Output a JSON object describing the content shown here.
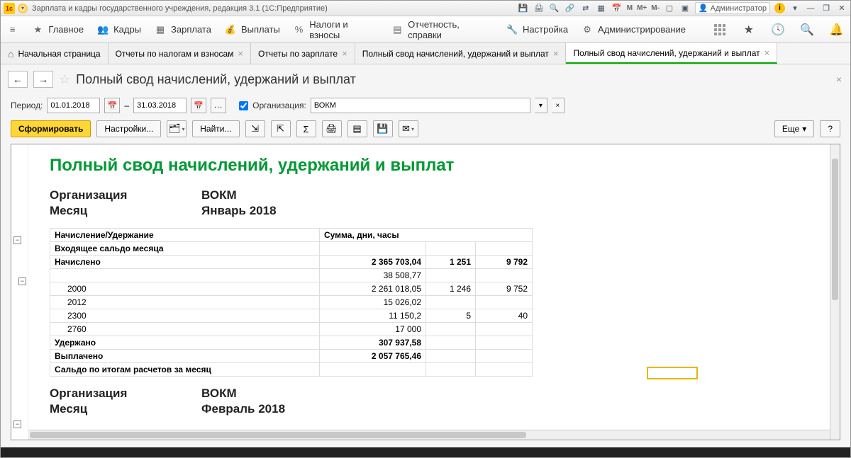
{
  "titlebar": {
    "title": "Зарплата и кадры государственного учреждения, редакция 3.1  (1С:Предприятие)",
    "m1": "M",
    "m2": "M+",
    "m3": "M-",
    "user": "Администратор"
  },
  "menu": {
    "main": "Главное",
    "kadry": "Кадры",
    "zarplata": "Зарплата",
    "vyplaty": "Выплаты",
    "nalogi": "Налоги и взносы",
    "otchet": "Отчетность, справки",
    "nastroyka": "Настройка",
    "admin": "Администрирование"
  },
  "tabs": {
    "home": "Начальная страница",
    "t1": "Отчеты по налогам и взносам",
    "t2": "Отчеты по зарплате",
    "t3": "Полный свод начислений, удержаний и выплат",
    "t4": "Полный свод начислений, удержаний и выплат"
  },
  "page": {
    "title": "Полный свод начислений, удержаний и выплат"
  },
  "filter": {
    "period_label": "Период:",
    "date_from": "01.01.2018",
    "dash": "–",
    "date_to": "31.03.2018",
    "org_label": "Организация:",
    "org_value": "ВОКМ"
  },
  "toolbar": {
    "generate": "Сформировать",
    "settings": "Настройки...",
    "find": "Найти...",
    "more": "Еще",
    "help": "?"
  },
  "report": {
    "title": "Полный свод начислений, удержаний и выплат",
    "org_label": "Организация",
    "org": "ВОКМ",
    "month_label": "Месяц",
    "month1": "Январь 2018",
    "month2": "Февраль 2018",
    "th_name": "Начисление/Удержание",
    "th_sum": "Сумма, дни, часы",
    "rows": {
      "r0": "Входящее сальдо месяца",
      "r1": "Начислено",
      "r1_sum": "2 365 703,04",
      "r1_d": "1 251",
      "r1_h": "9 792",
      "r2_sum": "38 508,77",
      "r3": "2000",
      "r3_sum": "2 261 018,05",
      "r3_d": "1 246",
      "r3_h": "9 752",
      "r4": "2012",
      "r4_sum": "15 026,02",
      "r5": "2300",
      "r5_sum": "11 150,2",
      "r5_d": "5",
      "r5_h": "40",
      "r6": "2760",
      "r6_sum": "17 000",
      "r7": "Удержано",
      "r7_sum": "307 937,58",
      "r8": "Выплачено",
      "r8_sum": "2 057 765,46",
      "r9": "Сальдо по итогам расчетов за месяц"
    }
  }
}
